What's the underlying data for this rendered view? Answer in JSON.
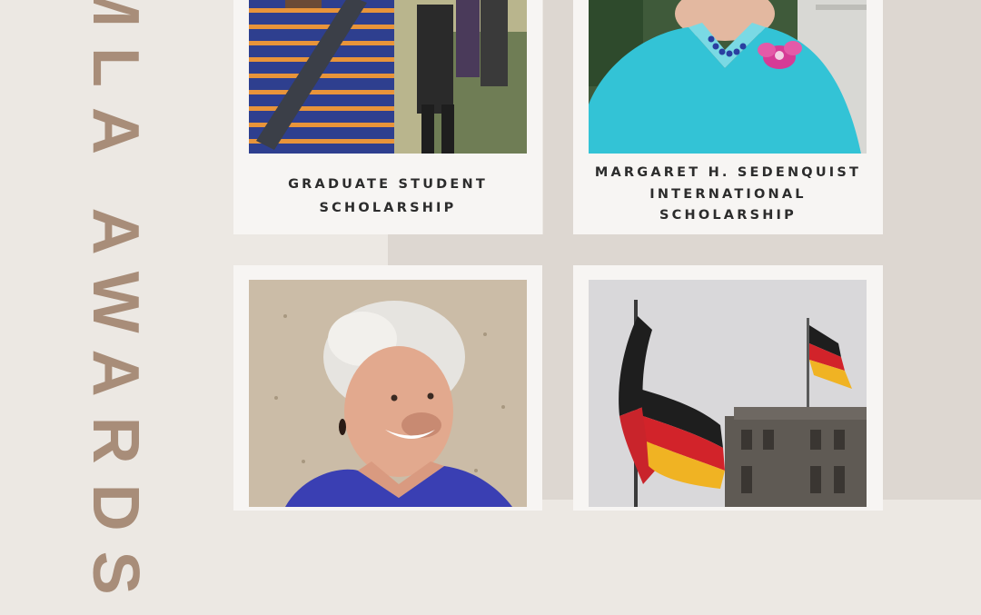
{
  "page": {
    "vertical_title": "MLA AWARDS"
  },
  "cards": [
    {
      "caption_line1": "GRADUATE STUDENT",
      "caption_line2": "SCHOLARSHIP",
      "photo_icon": "student-photo"
    },
    {
      "caption_line1": "MARGARET H. SEDENQUIST",
      "caption_line2": "INTERNATIONAL",
      "caption_line3": "SCHOLARSHIP",
      "photo_icon": "elderly-woman-photo"
    },
    {
      "photo_icon": "smiling-woman-photo"
    },
    {
      "photo_icon": "german-flag-photo"
    }
  ],
  "colors": {
    "background": "#ece8e3",
    "background_alt": "#ddd7d1",
    "title_color": "#a88d79",
    "card_bg": "#f7f5f3"
  }
}
